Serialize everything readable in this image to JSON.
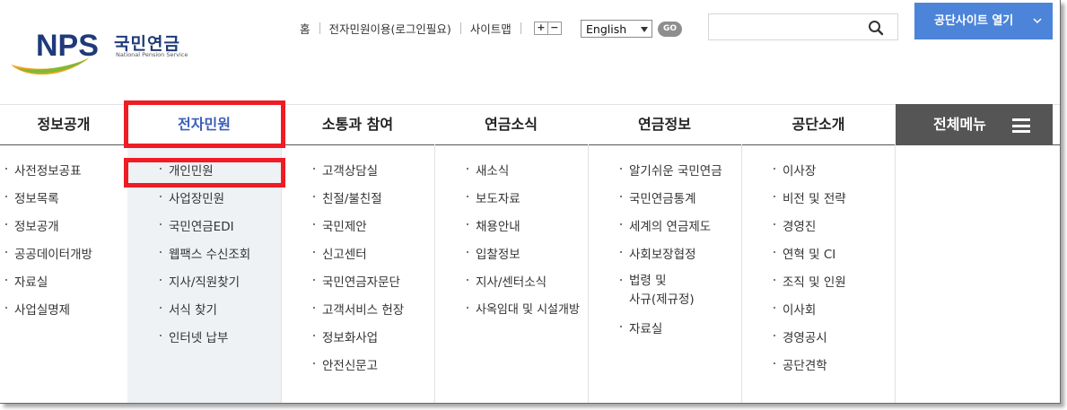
{
  "logo": {
    "mark": "NPS",
    "name_ko": "국민연금",
    "name_en": "National Pension Service"
  },
  "util": {
    "home": "홈",
    "epetition": "전자민원이용(로그인필요)",
    "sitemap": "사이트맵",
    "zoom_in": "+",
    "zoom_out": "−"
  },
  "language": {
    "selected": "English",
    "go": "GO"
  },
  "search": {
    "placeholder": ""
  },
  "open_site_button": "공단사이트 열기",
  "gnb": [
    "정보공개",
    "전자민원",
    "소통과 참여",
    "연금소식",
    "연금정보",
    "공단소개"
  ],
  "all_menu": "전체메뉴",
  "submenus": [
    [
      "사전정보공표",
      "정보목록",
      "정보공개",
      "공공데이터개방",
      "자료실",
      "사업실명제"
    ],
    [
      "개인민원",
      "사업장민원",
      "국민연금EDI",
      "웹팩스 수신조회",
      "지사/직원찾기",
      "서식 찾기",
      "인터넷 납부"
    ],
    [
      "고객상담실",
      "친절/불친절",
      "국민제안",
      "신고센터",
      "국민연금자문단",
      "고객서비스 헌장",
      "정보화사업",
      "안전신문고"
    ],
    [
      "새소식",
      "보도자료",
      "채용안내",
      "입찰정보",
      "지사/센터소식",
      "사옥임대 및 시설개방"
    ],
    [
      "알기쉬운 국민연금",
      "국민연금통계",
      "세계의 연금제도",
      "사회보장협정",
      "법령 및\n사규(제규정)",
      "자료실"
    ],
    [
      "이사장",
      "비전 및 전략",
      "경영진",
      "연혁 및 CI",
      "조직 및 인원",
      "이사회",
      "경영공시",
      "공단견학"
    ]
  ],
  "colors": {
    "accent_blue": "#4c84d9",
    "active_menu": "#3b5fb8",
    "highlight": "#ee1c24",
    "all_menu_bg": "#555555"
  }
}
